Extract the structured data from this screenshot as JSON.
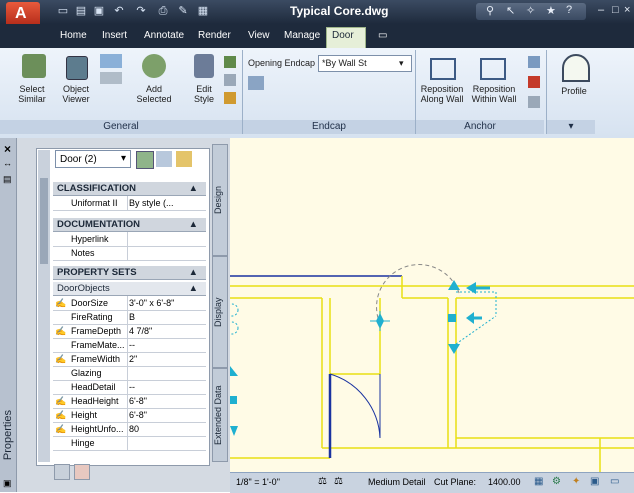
{
  "window": {
    "title": "Typical Core.dwg"
  },
  "quick_access": [
    "new-icon",
    "open-icon",
    "save-icon",
    "undo-icon",
    "redo-icon",
    "plot-icon",
    "match-icon",
    "workspace-icon"
  ],
  "help": {
    "icons": [
      "binoculars-icon",
      "pointer-icon",
      "satellite-icon",
      "star-icon",
      "help-icon"
    ]
  },
  "tabs": [
    "Home",
    "Insert",
    "Annotate",
    "Render",
    "View",
    "Manage",
    "Door"
  ],
  "active_tab": "Door",
  "ribbon": {
    "general": {
      "label": "General",
      "buttons": [
        "Select Similar",
        "Object Viewer",
        "Add Selected",
        "Edit Style"
      ]
    },
    "endcap": {
      "label": "Endcap",
      "opening_endcap": "Opening Endcap",
      "style_value": "*By Wall St"
    },
    "anchor": {
      "label": "Anchor",
      "buttons": [
        "Reposition Along Wall",
        "Reposition Within Wall"
      ]
    },
    "profile": {
      "label": "Profile"
    }
  },
  "palette": {
    "title": "Properties",
    "selection": "Door (2)",
    "tabs": [
      "Design",
      "Display",
      "Extended Data"
    ],
    "sections": {
      "classification": {
        "header": "CLASSIFICATION",
        "rows": [
          {
            "label": "Uniformat II",
            "value": "By style (..."
          }
        ]
      },
      "documentation": {
        "header": "DOCUMENTATION",
        "rows": [
          {
            "label": "Hyperlink",
            "value": ""
          },
          {
            "label": "Notes",
            "value": ""
          }
        ]
      },
      "property_sets": {
        "header": "PROPERTY SETS",
        "group": "DoorObjects",
        "rows": [
          {
            "label": "DoorSize",
            "value": "3'-0\" x 6'-8\""
          },
          {
            "label": "FireRating",
            "value": "B"
          },
          {
            "label": "FrameDepth",
            "value": "4 7/8\""
          },
          {
            "label": "FrameMate...",
            "value": "--"
          },
          {
            "label": "FrameWidth",
            "value": "2\""
          },
          {
            "label": "Glazing",
            "value": ""
          },
          {
            "label": "HeadDetail",
            "value": "--"
          },
          {
            "label": "HeadHeight",
            "value": "6'-8\""
          },
          {
            "label": "Height",
            "value": "6'-8\""
          },
          {
            "label": "HeightUnfo...",
            "value": "80"
          },
          {
            "label": "Hinge",
            "value": ""
          }
        ]
      }
    }
  },
  "status": {
    "scale": "1/8\" = 1'-0\"",
    "detail": "Medium Detail",
    "cut_plane_label": "Cut Plane:",
    "cut_plane_value": "1400.00"
  },
  "colors": {
    "accent": "#d8382c",
    "ribbon": "#dbe6f2",
    "drawing_bg": "#fffbe6",
    "lines": "#e8e014",
    "cyan": "#1fb0d0",
    "blue": "#1a33a0"
  }
}
